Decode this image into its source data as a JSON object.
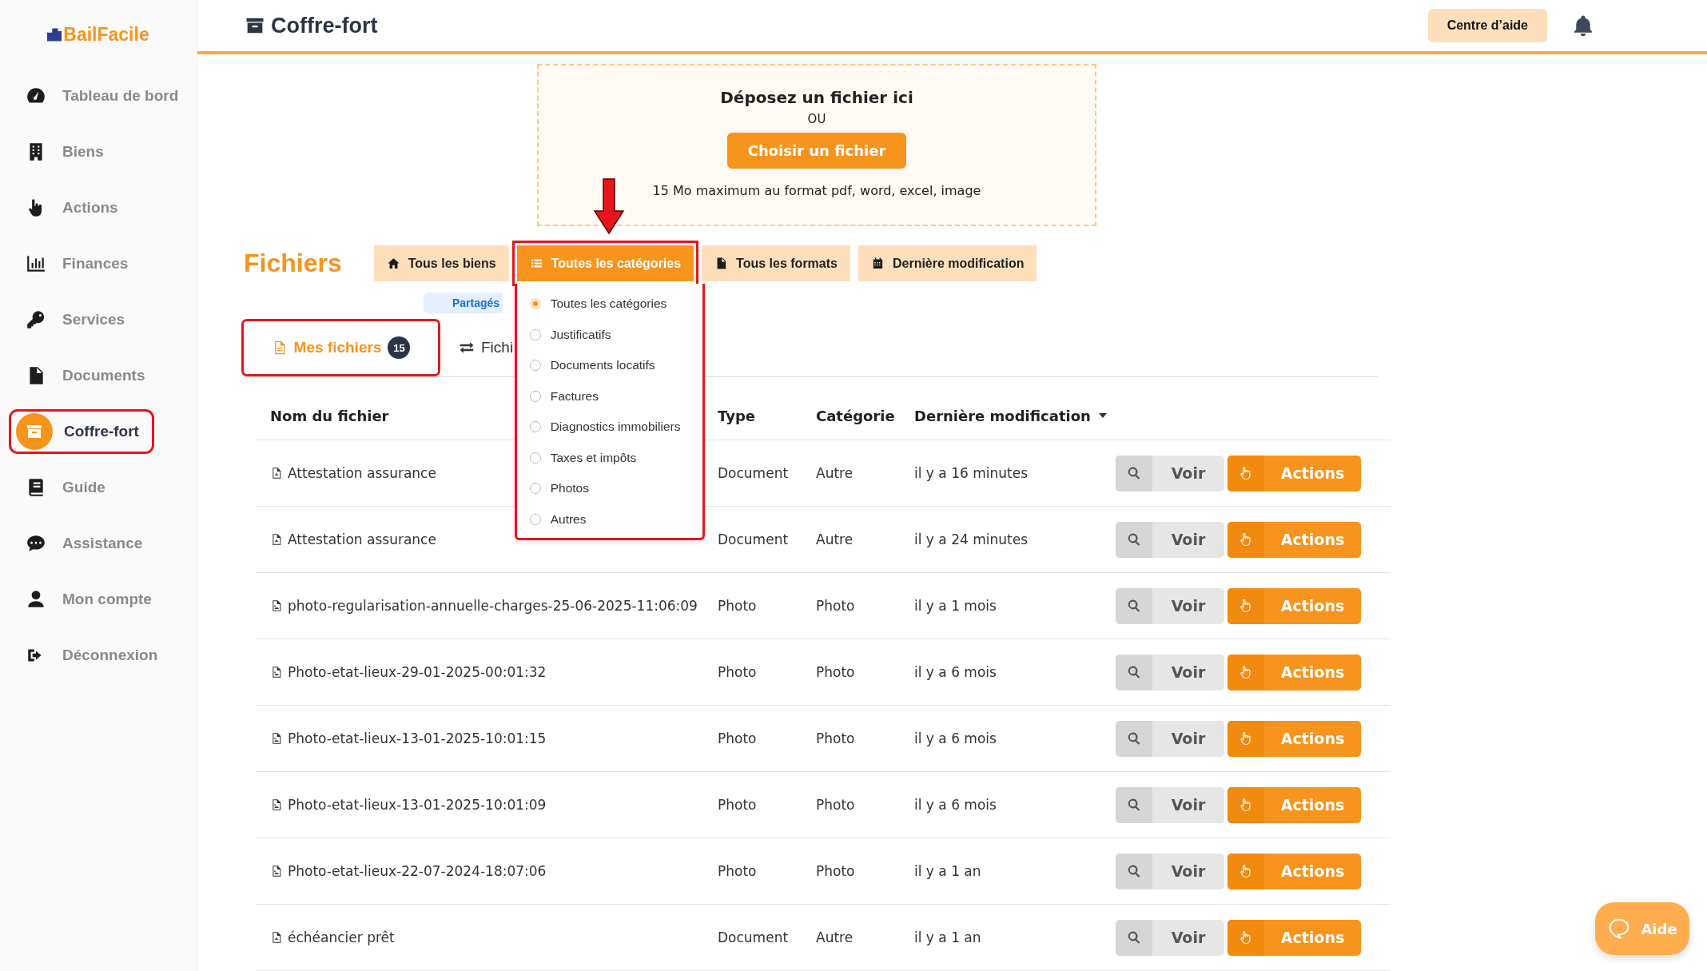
{
  "brand": "BailFacile",
  "sidebar": {
    "items": [
      {
        "label": "Tableau de bord",
        "selected": false
      },
      {
        "label": "Biens",
        "selected": false
      },
      {
        "label": "Actions",
        "selected": false
      },
      {
        "label": "Finances",
        "selected": false
      },
      {
        "label": "Services",
        "selected": false
      },
      {
        "label": "Documents",
        "selected": false
      },
      {
        "label": "Coffre-fort",
        "selected": true
      },
      {
        "label": "Guide",
        "selected": false
      },
      {
        "label": "Assistance",
        "selected": false
      },
      {
        "label": "Mon compte",
        "selected": false
      },
      {
        "label": "Déconnexion",
        "selected": false
      }
    ]
  },
  "header": {
    "title": "Coffre-fort",
    "help_button": "Centre d’aide"
  },
  "upload": {
    "title": "Déposez un fichier ici",
    "separator": "OU",
    "button": "Choisir un fichier",
    "hint": "15 Mo maximum au format pdf, word, excel, image"
  },
  "files": {
    "title": "Fichiers",
    "filters": [
      {
        "label": "Tous les biens",
        "selected": false
      },
      {
        "label": "Toutes les catégories",
        "selected": true
      },
      {
        "label": "Tous les formats",
        "selected": false
      },
      {
        "label": "Dernière modification",
        "selected": false
      }
    ],
    "category_menu": [
      {
        "label": "Toutes les catégories",
        "selected": true
      },
      {
        "label": "Justificatifs",
        "selected": false
      },
      {
        "label": "Documents locatifs",
        "selected": false
      },
      {
        "label": "Factures",
        "selected": false
      },
      {
        "label": "Diagnostics immobiliers",
        "selected": false
      },
      {
        "label": "Taxes et impôts",
        "selected": false
      },
      {
        "label": "Photos",
        "selected": false
      },
      {
        "label": "Autres",
        "selected": false
      }
    ],
    "shared_chip": "Partagés",
    "tabs": [
      {
        "label": "Mes fichiers",
        "count": "15",
        "selected": true
      },
      {
        "label": "Fichi",
        "selected": false
      }
    ],
    "table": {
      "columns": [
        "Nom du fichier",
        "Type",
        "Catégorie",
        "Dernière modification"
      ],
      "rows": [
        {
          "kind": "pdf",
          "name": "Attestation assurance",
          "type": "Document",
          "category": "Autre",
          "modified": "il y a 16 minutes",
          "view_button": "Voir",
          "actions_button": "Actions"
        },
        {
          "kind": "pdf",
          "name": "Attestation assurance",
          "type": "Document",
          "category": "Autre",
          "modified": "il y a 24 minutes",
          "view_button": "Voir",
          "actions_button": "Actions"
        },
        {
          "kind": "image",
          "name": "photo-regularisation-annuelle-charges-25-06-2025-11:06:09",
          "type": "Photo",
          "category": "Photo",
          "modified": "il y a 1 mois",
          "view_button": "Voir",
          "actions_button": "Actions"
        },
        {
          "kind": "image",
          "name": "Photo-etat-lieux-29-01-2025-00:01:32",
          "type": "Photo",
          "category": "Photo",
          "modified": "il y a 6 mois",
          "view_button": "Voir",
          "actions_button": "Actions"
        },
        {
          "kind": "image",
          "name": "Photo-etat-lieux-13-01-2025-10:01:15",
          "type": "Photo",
          "category": "Photo",
          "modified": "il y a 6 mois",
          "view_button": "Voir",
          "actions_button": "Actions"
        },
        {
          "kind": "image",
          "name": "Photo-etat-lieux-13-01-2025-10:01:09",
          "type": "Photo",
          "category": "Photo",
          "modified": "il y a 6 mois",
          "view_button": "Voir",
          "actions_button": "Actions"
        },
        {
          "kind": "image",
          "name": "Photo-etat-lieux-22-07-2024-18:07:06",
          "type": "Photo",
          "category": "Photo",
          "modified": "il y a 1 an",
          "view_button": "Voir",
          "actions_button": "Actions"
        },
        {
          "kind": "pdf",
          "name": "échéancier prêt",
          "type": "Document",
          "category": "Autre",
          "modified": "il y a 1 an",
          "view_button": "Voir",
          "actions_button": "Actions"
        }
      ]
    }
  },
  "help_widget": "Aide"
}
